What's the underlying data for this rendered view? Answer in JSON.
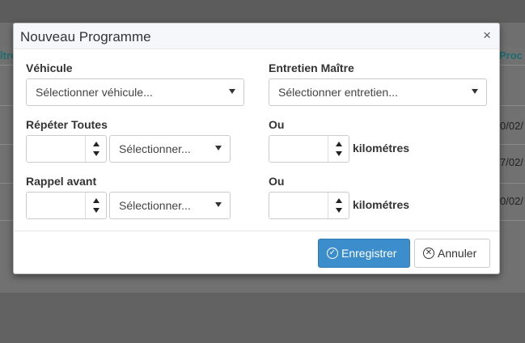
{
  "background": {
    "header_left": "ître",
    "header_right": "Proc",
    "cells": [
      "0/02/",
      "7/02/",
      "0/02/"
    ]
  },
  "modal": {
    "title": "Nouveau Programme",
    "close_glyph": "×",
    "vehicule": {
      "label": "Véhicule",
      "value": "Sélectionner véhicule..."
    },
    "entretien": {
      "label": "Entretien Maître",
      "value": "Sélectionner entretien..."
    },
    "repeter": {
      "label": "Répéter Toutes",
      "number_value": "",
      "unit_select": "Sélectionner..."
    },
    "ou1": {
      "label": "Ou",
      "number_value": "",
      "unit": "kilométres"
    },
    "rappel": {
      "label": "Rappel avant",
      "number_value": "",
      "unit_select": "Sélectionner..."
    },
    "ou2": {
      "label": "Ou",
      "number_value": "",
      "unit": "kilométres"
    },
    "footer": {
      "save_label": "Enregistrer",
      "cancel_label": "Annuler"
    }
  },
  "colors": {
    "primary": "#3c8dcb",
    "header_link": "#1d6c70"
  }
}
